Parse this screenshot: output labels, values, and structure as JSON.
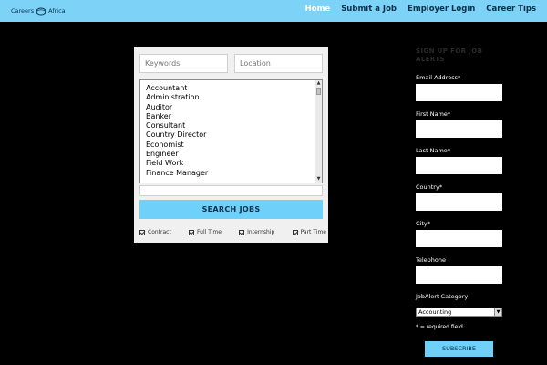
{
  "header": {
    "logo_left": "Careers",
    "logo_right": "Africa",
    "nav": [
      "Home",
      "Submit a Job",
      "Employer Login",
      "Career Tips"
    ]
  },
  "search": {
    "keywords_placeholder": "Keywords",
    "location_placeholder": "Location",
    "categories": [
      "Accountant",
      "Administration",
      "Auditor",
      "Banker",
      "Consultant",
      "Country Director",
      "Economist",
      "Engineer",
      "Field Work",
      "Finance Manager"
    ],
    "button": "SEARCH JOBS",
    "job_types": [
      "Contract",
      "Full Time",
      "Internship",
      "Part Time"
    ]
  },
  "alert": {
    "heading_line1": "SIGN UP FOR JOB",
    "heading_line2": "ALERTS",
    "email_label": "Email Address*",
    "first_label": "First Name*",
    "last_label": "Last Name*",
    "country_label": "Country*",
    "city_label": "City*",
    "phone_label": "Telephone",
    "category_label": "JobAlert Category",
    "category_value": "Accounting",
    "required_note": "* = required field",
    "subscribe": "SUBSCRIBE"
  },
  "colors": {
    "accent": "#7dd3f7",
    "background": "#000000",
    "nav_text": "#0b2f4a"
  }
}
